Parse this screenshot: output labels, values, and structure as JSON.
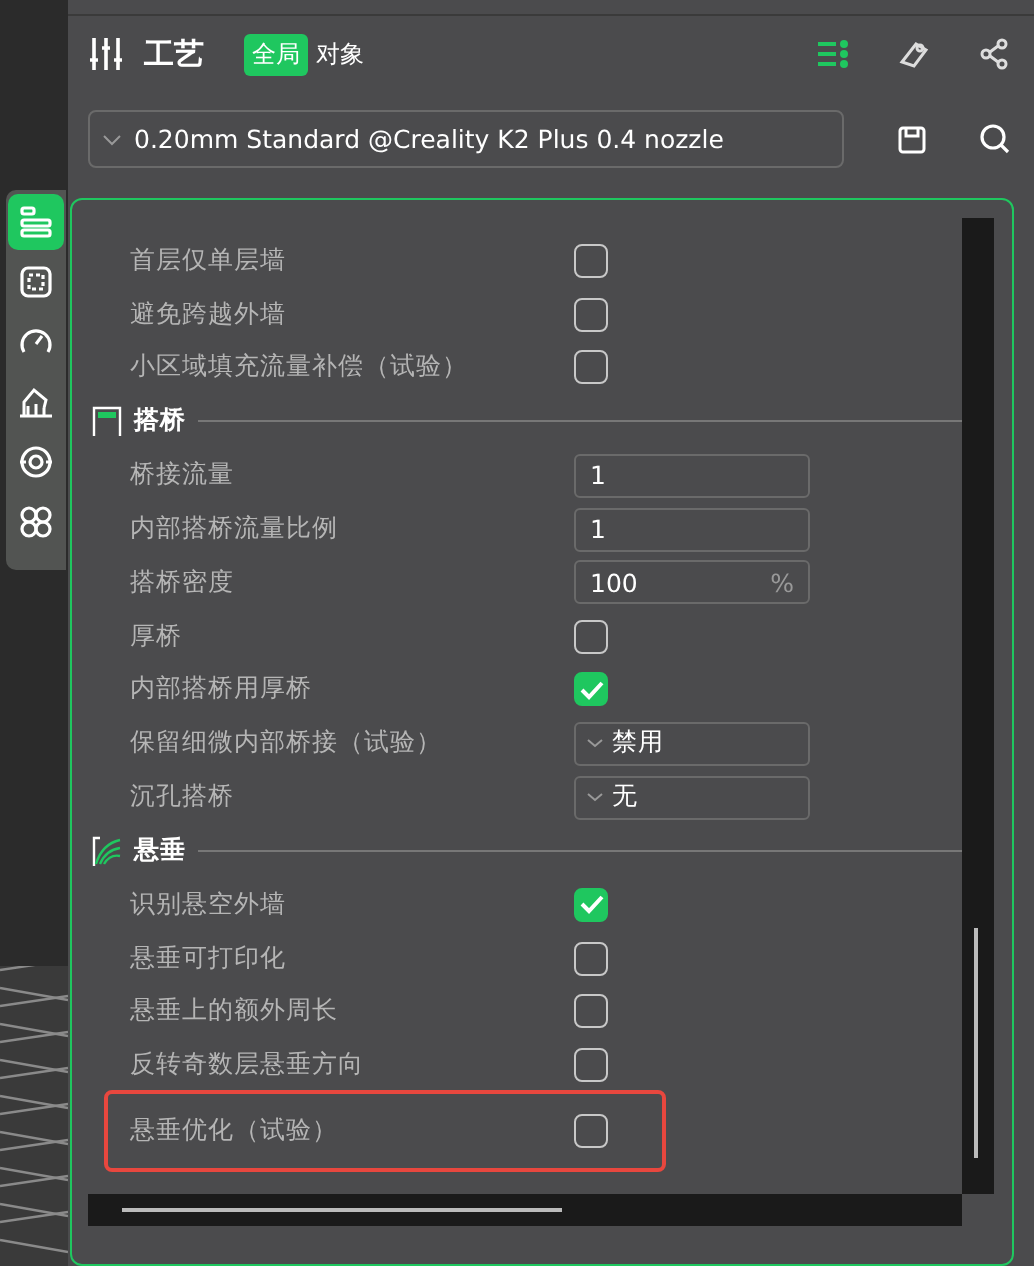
{
  "header": {
    "title": "工艺",
    "scope_tabs": [
      {
        "label": "全局",
        "selected": true
      },
      {
        "label": "对象",
        "selected": false
      }
    ],
    "tool_icons": [
      {
        "selected": true
      },
      {
        "selected": false
      },
      {
        "selected": false
      }
    ]
  },
  "preset": {
    "value": "0.20mm Standard @Creality K2 Plus 0.4 nozzle"
  },
  "side_tabs": [
    {
      "selected": true
    },
    {
      "selected": false
    },
    {
      "selected": false
    },
    {
      "selected": false
    },
    {
      "selected": false
    },
    {
      "selected": false
    }
  ],
  "sections": [
    {
      "rows": [
        {
          "label": "首层仅单层墙",
          "kind": "checkbox",
          "checked": false,
          "highlighted": false
        },
        {
          "label": "避免跨越外墙",
          "kind": "checkbox",
          "checked": false,
          "highlighted": false
        },
        {
          "label": "小区域填充流量补偿（试验）",
          "kind": "checkbox",
          "checked": false,
          "highlighted": false
        }
      ]
    },
    {
      "title": "搭桥",
      "rows": [
        {
          "label": "桥接流量",
          "kind": "number",
          "value": "1",
          "highlighted": false
        },
        {
          "label": "内部搭桥流量比例",
          "kind": "number",
          "value": "1",
          "highlighted": false
        },
        {
          "label": "搭桥密度",
          "kind": "number",
          "value": "100",
          "unit": "%",
          "highlighted": false
        },
        {
          "label": "厚桥",
          "kind": "checkbox",
          "checked": false,
          "highlighted": false
        },
        {
          "label": "内部搭桥用厚桥",
          "kind": "checkbox",
          "checked": true,
          "highlighted": false
        },
        {
          "label": "保留细微内部桥接（试验）",
          "kind": "select",
          "value": "禁用",
          "highlighted": false
        },
        {
          "label": "沉孔搭桥",
          "kind": "select",
          "value": "无",
          "highlighted": false
        }
      ]
    },
    {
      "title": "悬垂",
      "rows": [
        {
          "label": "识别悬空外墙",
          "kind": "checkbox",
          "checked": true,
          "highlighted": false
        },
        {
          "label": "悬垂可打印化",
          "kind": "checkbox",
          "checked": false,
          "highlighted": false
        },
        {
          "label": "悬垂上的额外周长",
          "kind": "checkbox",
          "checked": false,
          "highlighted": false
        },
        {
          "label": "反转奇数层悬垂方向",
          "kind": "checkbox",
          "checked": false,
          "highlighted": false
        },
        {
          "label": "悬垂优化（试验）",
          "kind": "checkbox",
          "checked": false,
          "highlighted": true
        }
      ]
    }
  ]
}
